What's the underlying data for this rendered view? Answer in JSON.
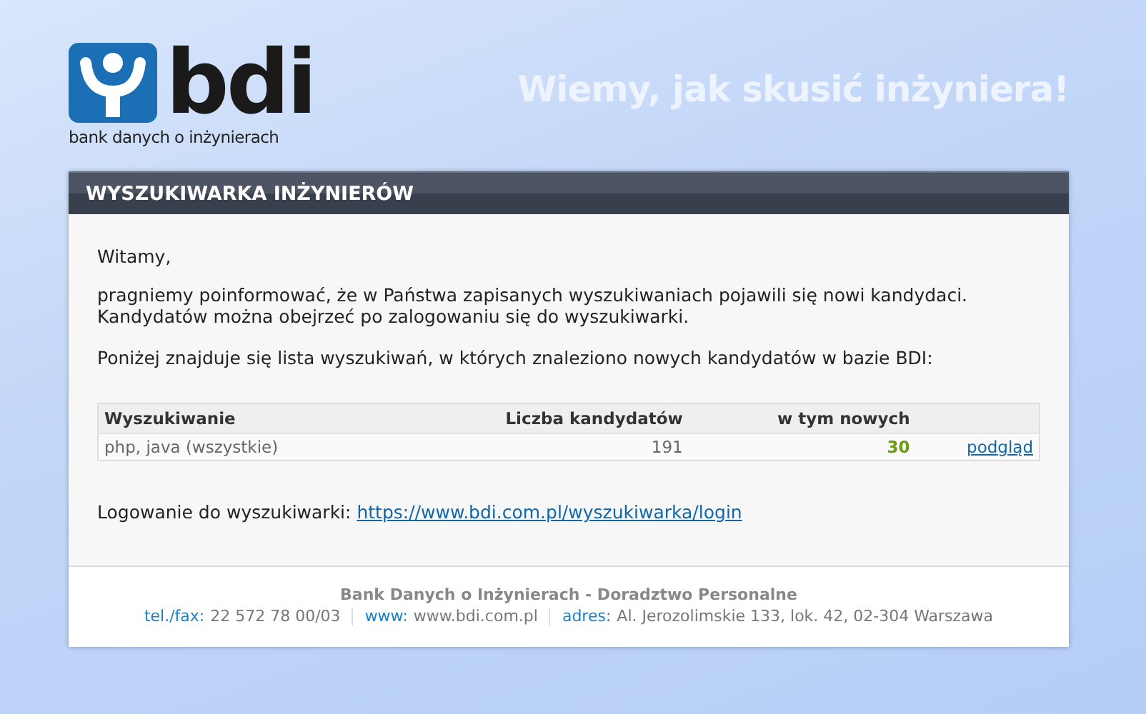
{
  "logo": {
    "wordmark": "bdi",
    "tagline": "bank danych o inżynierach"
  },
  "slogan": "Wiemy, jak skusić inżyniera!",
  "panel": {
    "title": "WYSZUKIWARKA INŻYNIERÓW"
  },
  "greeting": "Witamy,",
  "paragraphs": [
    "pragniemy poinformować, że w Państwa zapisanych wyszukiwaniach pojawili się nowi kandydaci. Kandydatów można obejrzeć po zalogowaniu się do wyszukiwarki.",
    "Poniżej znajduje się lista wyszukiwań, w których znaleziono nowych kandydatów w bazie BDI:"
  ],
  "table": {
    "columns": [
      "Wyszukiwanie",
      "Liczba kandydatów",
      "w tym nowych"
    ],
    "rows": [
      {
        "search": "php, java (wszystkie)",
        "candidates": "191",
        "new": "30",
        "link": "podgląd"
      }
    ]
  },
  "login": {
    "label": "Logowanie do wyszukiwarki:",
    "link": "https://www.bdi.com.pl/wyszukiwarka/login"
  },
  "footer": {
    "company": "Bank Danych o Inżynierach - Doradztwo Personalne",
    "contacts": [
      {
        "label": "tel./fax:",
        "value": "22 572 78 00/03"
      },
      {
        "label": "www:",
        "value": "www.bdi.com.pl"
      },
      {
        "label": "adres:",
        "value": "Al. Jerozolimskie 133, lok. 42, 02-304 Warszawa"
      }
    ]
  }
}
